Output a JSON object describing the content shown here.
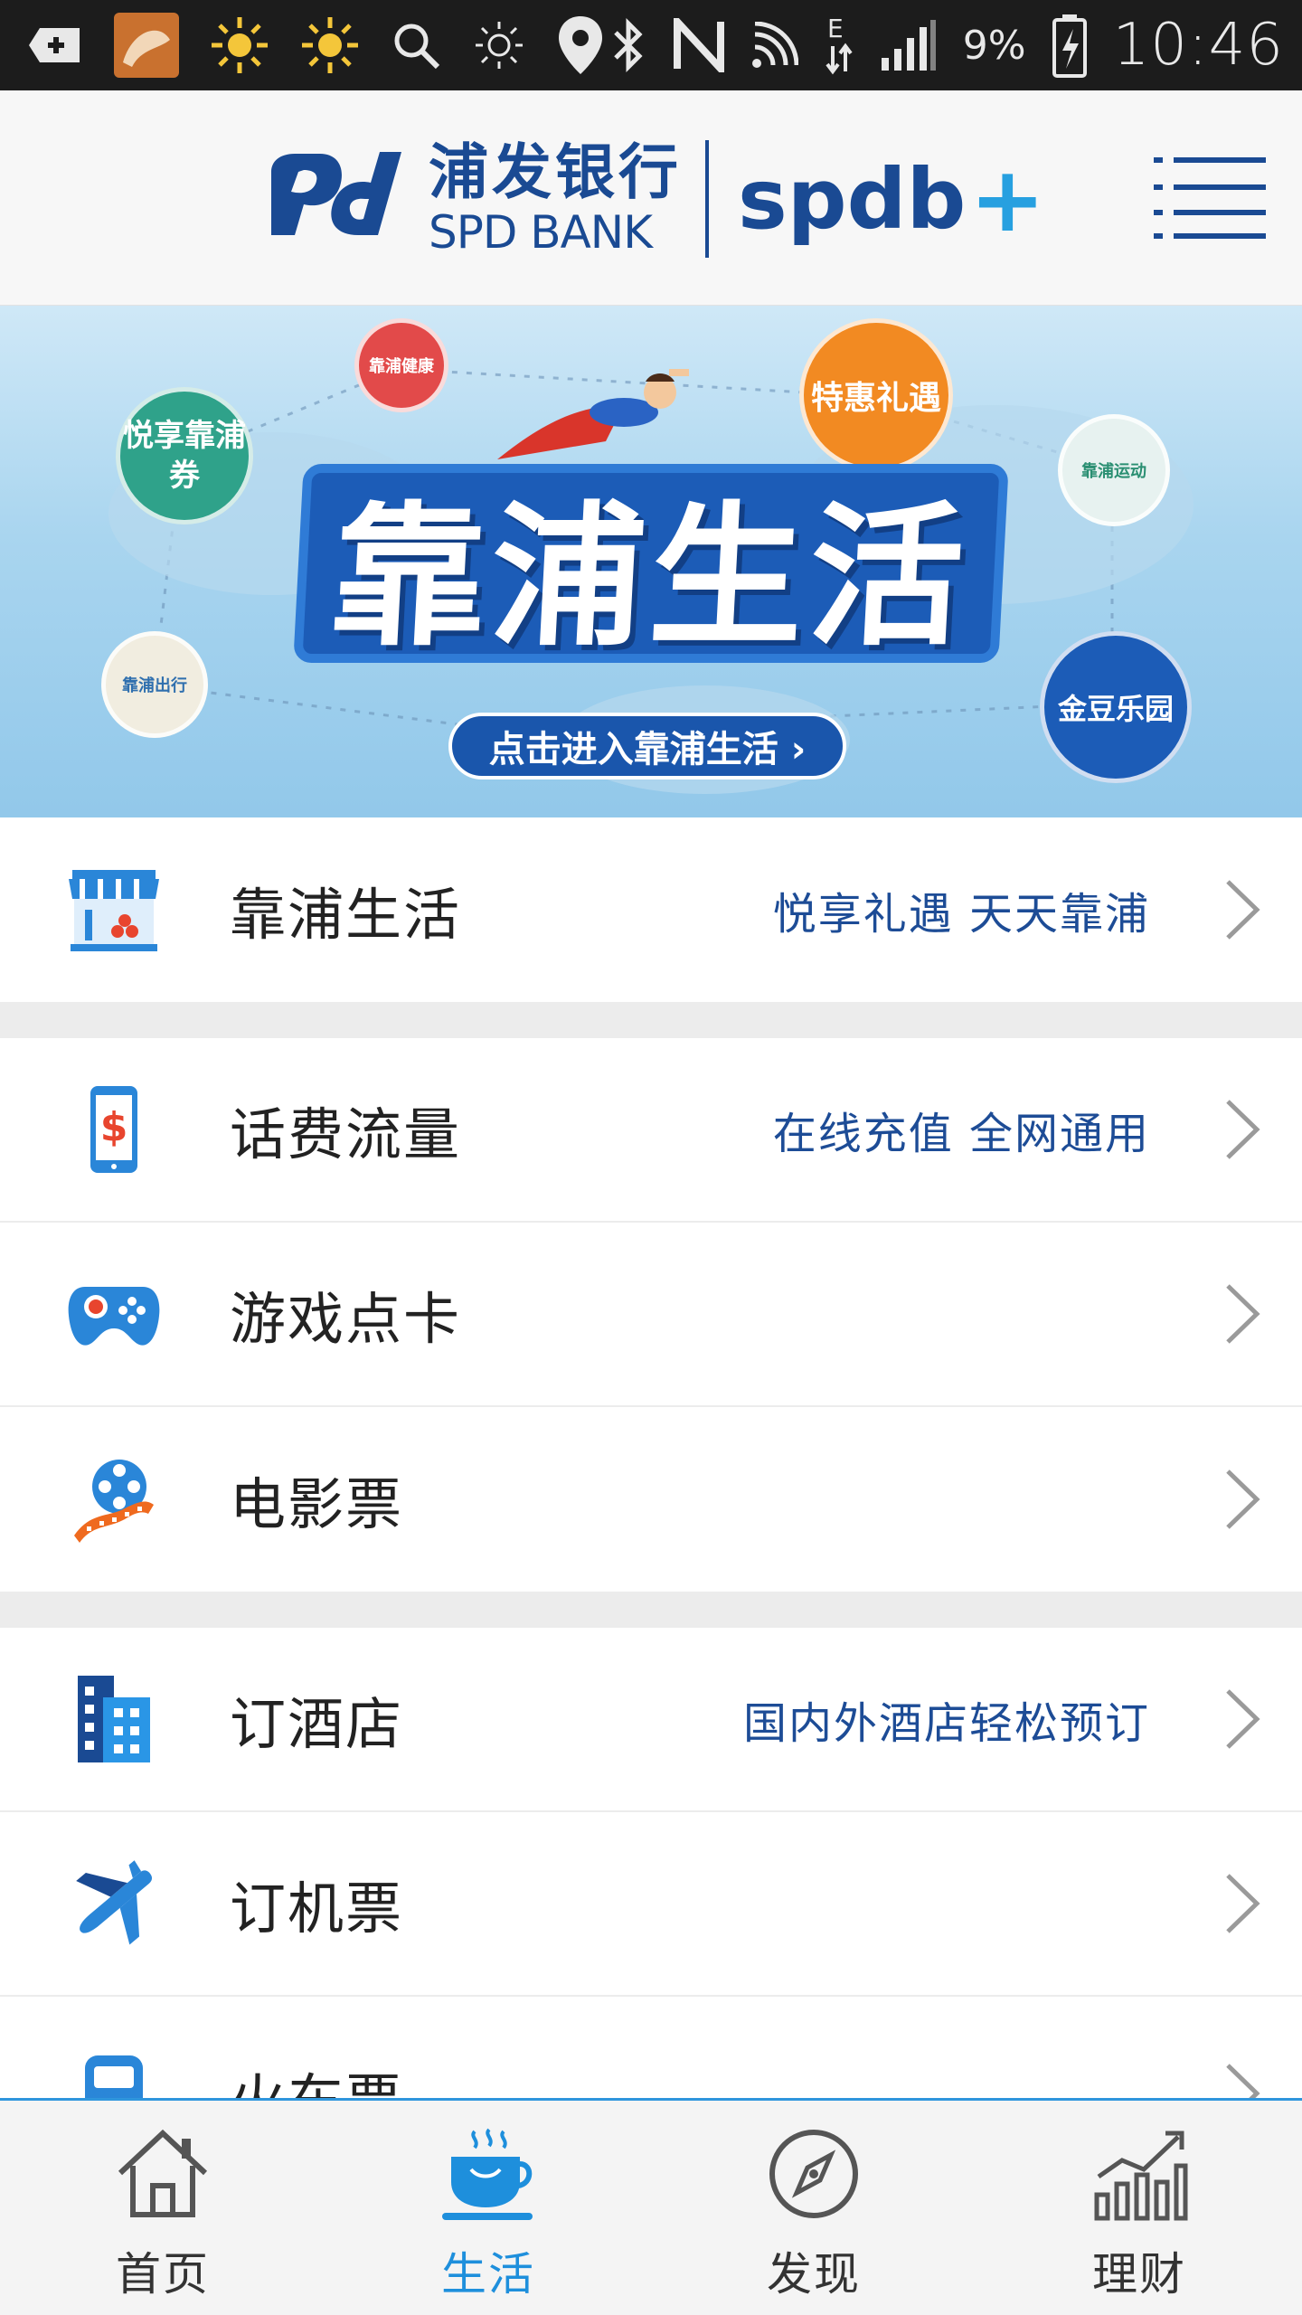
{
  "status_bar": {
    "battery_percent": "9%",
    "time": "10:46",
    "icons": [
      "add-box-icon",
      "app-thumb-icon",
      "sun-icon",
      "sun-icon",
      "search-icon",
      "brightness-icon",
      "location-icon",
      "bluetooth-icon",
      "nfc-icon",
      "cast-icon",
      "data-e-icon",
      "signal-icon",
      "battery-icon"
    ]
  },
  "header": {
    "brand_cn": "浦发银行",
    "brand_en": "SPD BANK",
    "brand_plus": "spdb",
    "plus_sign": "+"
  },
  "banner": {
    "title": "靠浦生活",
    "cta": "点击进入靠浦生活 ›",
    "bubbles": [
      "悦享靠浦券",
      "靠浦健康",
      "特惠礼遇",
      "靠浦运动",
      "靠浦出行",
      "金豆乐园"
    ]
  },
  "list": {
    "groups": [
      [
        {
          "label": "靠浦生活",
          "sub": "悦享礼遇  天天靠浦",
          "icon": "shop-icon"
        }
      ],
      [
        {
          "label": "话费流量",
          "sub": "在线充值  全网通用",
          "icon": "phone-charge-icon"
        },
        {
          "label": "游戏点卡",
          "sub": "",
          "icon": "gamepad-icon"
        },
        {
          "label": "电影票",
          "sub": "",
          "icon": "film-reel-icon"
        }
      ],
      [
        {
          "label": "订酒店",
          "sub": "国内外酒店轻松预订",
          "icon": "hotel-icon"
        },
        {
          "label": "订机票",
          "sub": "",
          "icon": "airplane-icon"
        },
        {
          "label": "火车票",
          "sub": "",
          "icon": "train-icon"
        }
      ]
    ]
  },
  "tabbar": {
    "tabs": [
      {
        "label": "首页",
        "icon": "home-icon",
        "active": false
      },
      {
        "label": "生活",
        "icon": "coffee-cup-icon",
        "active": true
      },
      {
        "label": "发现",
        "icon": "compass-icon",
        "active": false
      },
      {
        "label": "理财",
        "icon": "chart-growth-icon",
        "active": false
      }
    ]
  },
  "colors": {
    "brand_blue": "#1a4a93",
    "accent_blue": "#1e8fdc",
    "subtitle_blue": "#1d4c96"
  }
}
